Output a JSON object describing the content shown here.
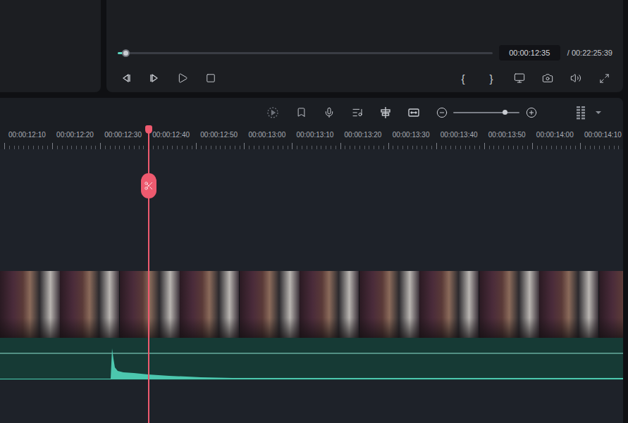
{
  "player": {
    "progress": {
      "level": 0.02
    },
    "current_time": "00:00:12:35",
    "total_time": "/ 00:22:25:39",
    "mark_in": "{",
    "mark_out": "}"
  },
  "timeline": {
    "zoom": {
      "level": 0.78
    },
    "ruler_labels": [
      "00:00:12:10",
      "00:00:12:20",
      "00:00:12:30",
      "00:00:12:40",
      "00:00:12:50",
      "00:00:13:00",
      "00:00:13:10",
      "00:00:13:20",
      "00:00:13:30",
      "00:00:13:40",
      "00:00:13:50",
      "00:00:14:00",
      "00:00:14:10"
    ]
  }
}
